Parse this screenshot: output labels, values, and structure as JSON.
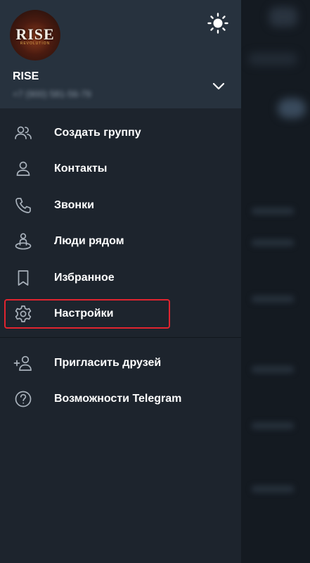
{
  "profile": {
    "name": "RISE",
    "phone": "+7 (900) 581-56-79",
    "avatar_logo": "RISE",
    "avatar_sub": "REVOLUTION"
  },
  "header_icons": {
    "theme_toggle": "sun-icon",
    "expand": "chevron-down-icon"
  },
  "menu": {
    "items": [
      {
        "label": "Создать группу",
        "icon": "group-icon"
      },
      {
        "label": "Контакты",
        "icon": "person-icon"
      },
      {
        "label": "Звонки",
        "icon": "phone-icon"
      },
      {
        "label": "Люди рядом",
        "icon": "people-nearby-icon"
      },
      {
        "label": "Избранное",
        "icon": "bookmark-icon"
      },
      {
        "label": "Настройки",
        "icon": "gear-icon",
        "highlighted": true
      }
    ],
    "secondary": [
      {
        "label": "Пригласить друзей",
        "icon": "add-person-icon"
      },
      {
        "label": "Возможности Telegram",
        "icon": "help-icon"
      }
    ]
  },
  "colors": {
    "header_bg": "#27323e",
    "drawer_bg": "#1d242d",
    "highlight": "#e0242f",
    "icon": "#a9b2bc"
  }
}
